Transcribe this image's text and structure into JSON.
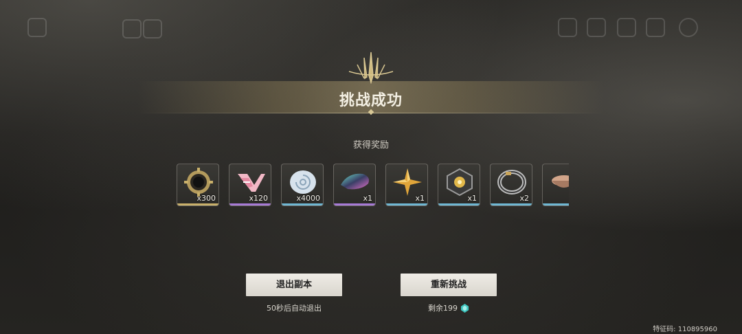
{
  "result": {
    "title": "挑战成功",
    "rewards_label": "获得奖励"
  },
  "rewards": [
    {
      "icon": "gear-coin-icon",
      "qty": "x300",
      "rarity_color": "#c9b06a"
    },
    {
      "icon": "pink-ribbon-icon",
      "qty": "x120",
      "rarity_color": "#a77ad6"
    },
    {
      "icon": "shell-icon",
      "qty": "x4000",
      "rarity_color": "#6fb7d3"
    },
    {
      "icon": "iridescent-stone-icon",
      "qty": "x1",
      "rarity_color": "#a77ad6"
    },
    {
      "icon": "shuriken-star-icon",
      "qty": "x1",
      "rarity_color": "#6fb7d3"
    },
    {
      "icon": "golden-core-icon",
      "qty": "x1",
      "rarity_color": "#6fb7d3"
    },
    {
      "icon": "ring-icon",
      "qty": "x2",
      "rarity_color": "#6fb7d3"
    },
    {
      "icon": "bowl-icon",
      "qty": "",
      "rarity_color": "#6fb7d3"
    }
  ],
  "actions": {
    "exit_label": "退出副本",
    "exit_note": "50秒后自动退出",
    "retry_label": "重新挑战",
    "retry_note": "剩余199"
  },
  "footer": {
    "feature_code": "特征码: 110895960"
  }
}
